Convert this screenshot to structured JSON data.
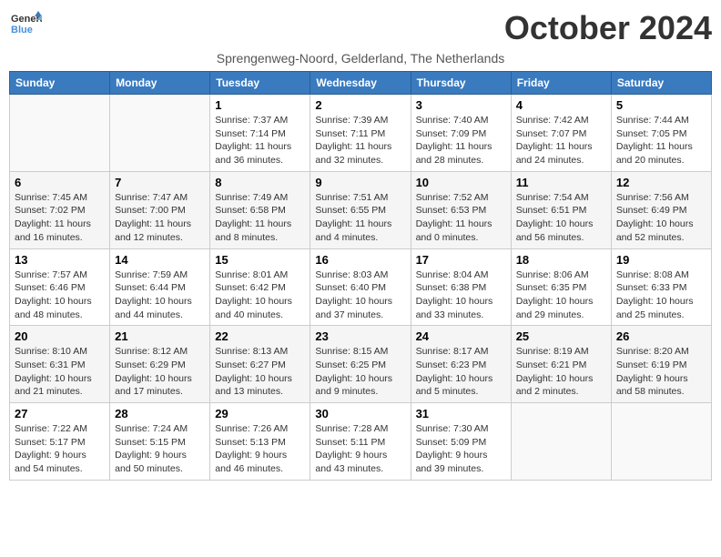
{
  "logo": {
    "line1": "General",
    "line2": "Blue"
  },
  "title": "October 2024",
  "subtitle": "Sprengenweg-Noord, Gelderland, The Netherlands",
  "days_of_week": [
    "Sunday",
    "Monday",
    "Tuesday",
    "Wednesday",
    "Thursday",
    "Friday",
    "Saturday"
  ],
  "weeks": [
    [
      {
        "day": "",
        "sunrise": "",
        "sunset": "",
        "daylight": ""
      },
      {
        "day": "",
        "sunrise": "",
        "sunset": "",
        "daylight": ""
      },
      {
        "day": "1",
        "sunrise": "Sunrise: 7:37 AM",
        "sunset": "Sunset: 7:14 PM",
        "daylight": "Daylight: 11 hours and 36 minutes."
      },
      {
        "day": "2",
        "sunrise": "Sunrise: 7:39 AM",
        "sunset": "Sunset: 7:11 PM",
        "daylight": "Daylight: 11 hours and 32 minutes."
      },
      {
        "day": "3",
        "sunrise": "Sunrise: 7:40 AM",
        "sunset": "Sunset: 7:09 PM",
        "daylight": "Daylight: 11 hours and 28 minutes."
      },
      {
        "day": "4",
        "sunrise": "Sunrise: 7:42 AM",
        "sunset": "Sunset: 7:07 PM",
        "daylight": "Daylight: 11 hours and 24 minutes."
      },
      {
        "day": "5",
        "sunrise": "Sunrise: 7:44 AM",
        "sunset": "Sunset: 7:05 PM",
        "daylight": "Daylight: 11 hours and 20 minutes."
      }
    ],
    [
      {
        "day": "6",
        "sunrise": "Sunrise: 7:45 AM",
        "sunset": "Sunset: 7:02 PM",
        "daylight": "Daylight: 11 hours and 16 minutes."
      },
      {
        "day": "7",
        "sunrise": "Sunrise: 7:47 AM",
        "sunset": "Sunset: 7:00 PM",
        "daylight": "Daylight: 11 hours and 12 minutes."
      },
      {
        "day": "8",
        "sunrise": "Sunrise: 7:49 AM",
        "sunset": "Sunset: 6:58 PM",
        "daylight": "Daylight: 11 hours and 8 minutes."
      },
      {
        "day": "9",
        "sunrise": "Sunrise: 7:51 AM",
        "sunset": "Sunset: 6:55 PM",
        "daylight": "Daylight: 11 hours and 4 minutes."
      },
      {
        "day": "10",
        "sunrise": "Sunrise: 7:52 AM",
        "sunset": "Sunset: 6:53 PM",
        "daylight": "Daylight: 11 hours and 0 minutes."
      },
      {
        "day": "11",
        "sunrise": "Sunrise: 7:54 AM",
        "sunset": "Sunset: 6:51 PM",
        "daylight": "Daylight: 10 hours and 56 minutes."
      },
      {
        "day": "12",
        "sunrise": "Sunrise: 7:56 AM",
        "sunset": "Sunset: 6:49 PM",
        "daylight": "Daylight: 10 hours and 52 minutes."
      }
    ],
    [
      {
        "day": "13",
        "sunrise": "Sunrise: 7:57 AM",
        "sunset": "Sunset: 6:46 PM",
        "daylight": "Daylight: 10 hours and 48 minutes."
      },
      {
        "day": "14",
        "sunrise": "Sunrise: 7:59 AM",
        "sunset": "Sunset: 6:44 PM",
        "daylight": "Daylight: 10 hours and 44 minutes."
      },
      {
        "day": "15",
        "sunrise": "Sunrise: 8:01 AM",
        "sunset": "Sunset: 6:42 PM",
        "daylight": "Daylight: 10 hours and 40 minutes."
      },
      {
        "day": "16",
        "sunrise": "Sunrise: 8:03 AM",
        "sunset": "Sunset: 6:40 PM",
        "daylight": "Daylight: 10 hours and 37 minutes."
      },
      {
        "day": "17",
        "sunrise": "Sunrise: 8:04 AM",
        "sunset": "Sunset: 6:38 PM",
        "daylight": "Daylight: 10 hours and 33 minutes."
      },
      {
        "day": "18",
        "sunrise": "Sunrise: 8:06 AM",
        "sunset": "Sunset: 6:35 PM",
        "daylight": "Daylight: 10 hours and 29 minutes."
      },
      {
        "day": "19",
        "sunrise": "Sunrise: 8:08 AM",
        "sunset": "Sunset: 6:33 PM",
        "daylight": "Daylight: 10 hours and 25 minutes."
      }
    ],
    [
      {
        "day": "20",
        "sunrise": "Sunrise: 8:10 AM",
        "sunset": "Sunset: 6:31 PM",
        "daylight": "Daylight: 10 hours and 21 minutes."
      },
      {
        "day": "21",
        "sunrise": "Sunrise: 8:12 AM",
        "sunset": "Sunset: 6:29 PM",
        "daylight": "Daylight: 10 hours and 17 minutes."
      },
      {
        "day": "22",
        "sunrise": "Sunrise: 8:13 AM",
        "sunset": "Sunset: 6:27 PM",
        "daylight": "Daylight: 10 hours and 13 minutes."
      },
      {
        "day": "23",
        "sunrise": "Sunrise: 8:15 AM",
        "sunset": "Sunset: 6:25 PM",
        "daylight": "Daylight: 10 hours and 9 minutes."
      },
      {
        "day": "24",
        "sunrise": "Sunrise: 8:17 AM",
        "sunset": "Sunset: 6:23 PM",
        "daylight": "Daylight: 10 hours and 5 minutes."
      },
      {
        "day": "25",
        "sunrise": "Sunrise: 8:19 AM",
        "sunset": "Sunset: 6:21 PM",
        "daylight": "Daylight: 10 hours and 2 minutes."
      },
      {
        "day": "26",
        "sunrise": "Sunrise: 8:20 AM",
        "sunset": "Sunset: 6:19 PM",
        "daylight": "Daylight: 9 hours and 58 minutes."
      }
    ],
    [
      {
        "day": "27",
        "sunrise": "Sunrise: 7:22 AM",
        "sunset": "Sunset: 5:17 PM",
        "daylight": "Daylight: 9 hours and 54 minutes."
      },
      {
        "day": "28",
        "sunrise": "Sunrise: 7:24 AM",
        "sunset": "Sunset: 5:15 PM",
        "daylight": "Daylight: 9 hours and 50 minutes."
      },
      {
        "day": "29",
        "sunrise": "Sunrise: 7:26 AM",
        "sunset": "Sunset: 5:13 PM",
        "daylight": "Daylight: 9 hours and 46 minutes."
      },
      {
        "day": "30",
        "sunrise": "Sunrise: 7:28 AM",
        "sunset": "Sunset: 5:11 PM",
        "daylight": "Daylight: 9 hours and 43 minutes."
      },
      {
        "day": "31",
        "sunrise": "Sunrise: 7:30 AM",
        "sunset": "Sunset: 5:09 PM",
        "daylight": "Daylight: 9 hours and 39 minutes."
      },
      {
        "day": "",
        "sunrise": "",
        "sunset": "",
        "daylight": ""
      },
      {
        "day": "",
        "sunrise": "",
        "sunset": "",
        "daylight": ""
      }
    ]
  ]
}
